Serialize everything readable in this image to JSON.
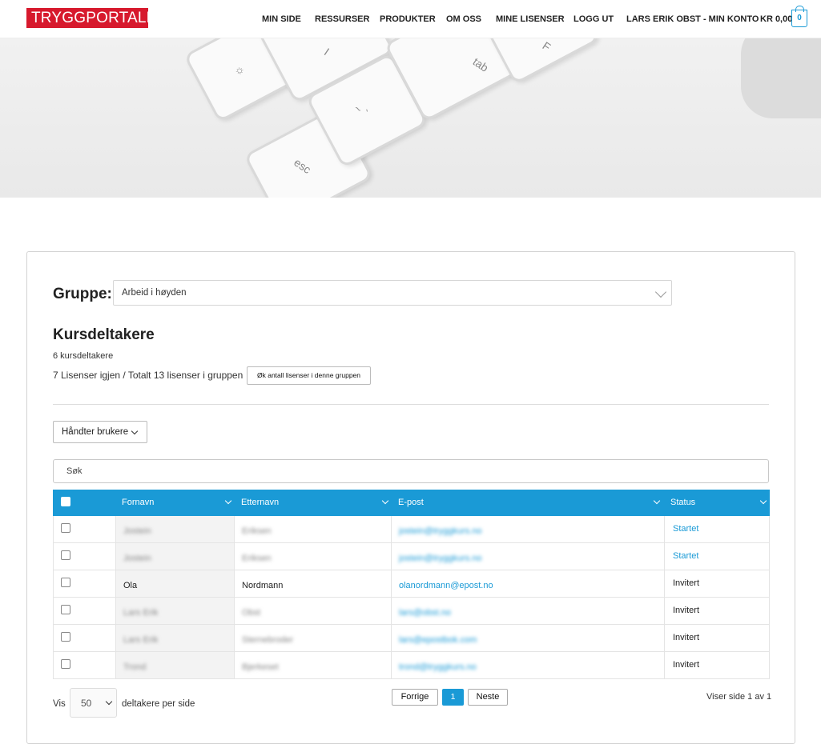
{
  "header": {
    "logo": "TRYGGPORTALEN",
    "nav": [
      {
        "label": "MIN SIDE",
        "highlight": false
      },
      {
        "label": "RESSURSER",
        "highlight": false
      },
      {
        "label": "PRODUKTER",
        "highlight": false
      },
      {
        "label": "OM OSS",
        "highlight": false
      },
      {
        "label": "MINE LISENSER",
        "highlight": true
      },
      {
        "label": "LOGG UT",
        "highlight": false
      },
      {
        "label": "LARS ERIK OBST - MIN KONTO",
        "highlight": true
      }
    ],
    "cart_total": "KR 0,00",
    "cart_count": "0"
  },
  "hero": {
    "keys": [
      "esc",
      "~ `",
      "☼",
      "tab",
      "F",
      "I"
    ]
  },
  "group": {
    "label": "Gruppe:",
    "selected": "Arbeid i høyden"
  },
  "participants": {
    "title": "Kursdeltakere",
    "count_text": "6 kursdeltakere",
    "license_text": "7 Lisenser igjen / Totalt 13 lisenser i gruppen",
    "increase_button": "Øk antall lisenser i denne gruppen"
  },
  "manage_button": "Håndter brukere",
  "search": {
    "placeholder": "Søk"
  },
  "table": {
    "columns": [
      "Fornavn",
      "Etternavn",
      "E-post",
      "Status"
    ],
    "rows": [
      {
        "first": "Jostein",
        "last": "Eriksen",
        "email": "jostein@tryggkurs.no",
        "status": "Startet",
        "status_link": true,
        "blurred": true
      },
      {
        "first": "Jostein",
        "last": "Eriksen",
        "email": "jostein@tryggkurs.no",
        "status": "Startet",
        "status_link": true,
        "blurred": true
      },
      {
        "first": "Ola",
        "last": "Nordmann",
        "email": "olanordmann@epost.no",
        "status": "Invitert",
        "status_link": false,
        "blurred": false
      },
      {
        "first": "Lars Erik",
        "last": "Obst",
        "email": "lars@obst.no",
        "status": "Invitert",
        "status_link": false,
        "blurred": true
      },
      {
        "first": "Lars Erik",
        "last": "Sternebroder",
        "email": "lars@epostbok.com",
        "status": "Invitert",
        "status_link": false,
        "blurred": true
      },
      {
        "first": "Trond",
        "last": "Bjerkeset",
        "email": "trond@tryggkurs.no",
        "status": "Invitert",
        "status_link": false,
        "blurred": true
      }
    ]
  },
  "pagination": {
    "show_label": "Vis",
    "per_page": "50",
    "per_page_label": "deltakere per side",
    "prev": "Forrige",
    "current": "1",
    "next": "Neste",
    "info": "Viser side 1 av 1"
  }
}
